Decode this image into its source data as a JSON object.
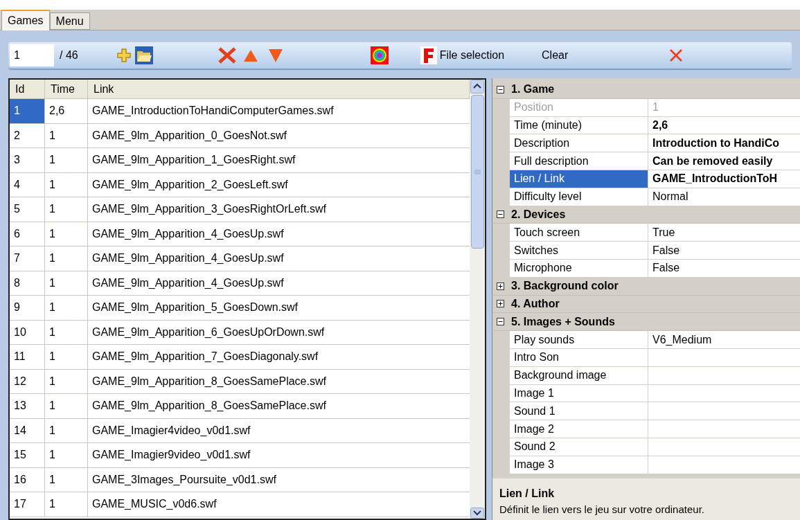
{
  "tabs": [
    {
      "label": "Games",
      "selected": true
    },
    {
      "label": "Menu",
      "selected": false
    }
  ],
  "toolbar": {
    "page_field": "1",
    "page_total": "/ 46",
    "file_selection": "File selection",
    "clear": "Clear"
  },
  "table": {
    "columns": [
      "Id",
      "Time",
      "Link"
    ],
    "rows": [
      {
        "id": "1",
        "time": "2,6",
        "link": "GAME_IntroductionToHandiComputerGames.swf",
        "selected": true
      },
      {
        "id": "2",
        "time": "1",
        "link": "GAME_9lm_Apparition_0_GoesNot.swf",
        "selected": false
      },
      {
        "id": "3",
        "time": "1",
        "link": "GAME_9lm_Apparition_1_GoesRight.swf",
        "selected": false
      },
      {
        "id": "4",
        "time": "1",
        "link": "GAME_9lm_Apparition_2_GoesLeft.swf",
        "selected": false
      },
      {
        "id": "5",
        "time": "1",
        "link": "GAME_9lm_Apparition_3_GoesRightOrLeft.swf",
        "selected": false
      },
      {
        "id": "6",
        "time": "1",
        "link": "GAME_9lm_Apparition_4_GoesUp.swf",
        "selected": false
      },
      {
        "id": "7",
        "time": "1",
        "link": "GAME_9lm_Apparition_4_GoesUp.swf",
        "selected": false
      },
      {
        "id": "8",
        "time": "1",
        "link": "GAME_9lm_Apparition_4_GoesUp.swf",
        "selected": false
      },
      {
        "id": "9",
        "time": "1",
        "link": "GAME_9lm_Apparition_5_GoesDown.swf",
        "selected": false
      },
      {
        "id": "10",
        "time": "1",
        "link": "GAME_9lm_Apparition_6_GoesUpOrDown.swf",
        "selected": false
      },
      {
        "id": "11",
        "time": "1",
        "link": "GAME_9lm_Apparition_7_GoesDiagonaly.swf",
        "selected": false
      },
      {
        "id": "12",
        "time": "1",
        "link": "GAME_9lm_Apparition_8_GoesSamePlace.swf",
        "selected": false
      },
      {
        "id": "13",
        "time": "1",
        "link": "GAME_9lm_Apparition_8_GoesSamePlace.swf",
        "selected": false
      },
      {
        "id": "14",
        "time": "1",
        "link": "GAME_Imagier4video_v0d1.swf",
        "selected": false
      },
      {
        "id": "15",
        "time": "1",
        "link": "GAME_Imagier9video_v0d1.swf",
        "selected": false
      },
      {
        "id": "16",
        "time": "1",
        "link": "GAME_3Images_Poursuite_v0d1.swf",
        "selected": false
      },
      {
        "id": "17",
        "time": "1",
        "link": "GAME_MUSIC_v0d6.swf",
        "selected": false
      }
    ]
  },
  "properties": [
    {
      "title": "1. Game",
      "expanded": true,
      "items": [
        {
          "label": "Position",
          "value": "1",
          "disabled": true,
          "bold": false,
          "selected": false
        },
        {
          "label": "Time (minute)",
          "value": "2,6",
          "disabled": false,
          "bold": true,
          "selected": false
        },
        {
          "label": "Description",
          "value": "Introduction to HandiCo",
          "disabled": false,
          "bold": true,
          "selected": false
        },
        {
          "label": "Full description",
          "value": "Can be removed easily",
          "disabled": false,
          "bold": true,
          "selected": false
        },
        {
          "label": "Lien / Link",
          "value": "GAME_IntroductionToH",
          "disabled": false,
          "bold": true,
          "selected": true
        },
        {
          "label": "Difficulty level",
          "value": "Normal",
          "disabled": false,
          "bold": false,
          "selected": false
        }
      ]
    },
    {
      "title": "2. Devices",
      "expanded": true,
      "items": [
        {
          "label": "Touch screen",
          "value": "True",
          "disabled": false,
          "bold": false,
          "selected": false
        },
        {
          "label": "Switches",
          "value": "False",
          "disabled": false,
          "bold": false,
          "selected": false
        },
        {
          "label": "Microphone",
          "value": "False",
          "disabled": false,
          "bold": false,
          "selected": false
        }
      ]
    },
    {
      "title": "3. Background color",
      "expanded": false
    },
    {
      "title": "4. Author",
      "expanded": false
    },
    {
      "title": "5. Images + Sounds",
      "expanded": true,
      "items": [
        {
          "label": "Play sounds",
          "value": "V6_Medium",
          "disabled": false,
          "bold": false,
          "selected": false
        },
        {
          "label": "Intro Son",
          "disabled": false,
          "bold": false,
          "selected": false
        },
        {
          "label": "Background image",
          "disabled": false,
          "bold": false,
          "selected": false
        },
        {
          "label": "Image 1",
          "disabled": false,
          "bold": false,
          "selected": false
        },
        {
          "label": "Sound 1",
          "disabled": false,
          "bold": false,
          "selected": false
        },
        {
          "label": "Image 2",
          "disabled": false,
          "bold": false,
          "selected": false
        },
        {
          "label": "Sound 2",
          "disabled": false,
          "bold": false,
          "selected": false
        },
        {
          "label": "Image 3",
          "disabled": false,
          "bold": false,
          "selected": false
        }
      ]
    }
  ],
  "help": {
    "title": "Lien / Link",
    "text": "Définit le lien vers le jeu sur votre ordinateur."
  }
}
